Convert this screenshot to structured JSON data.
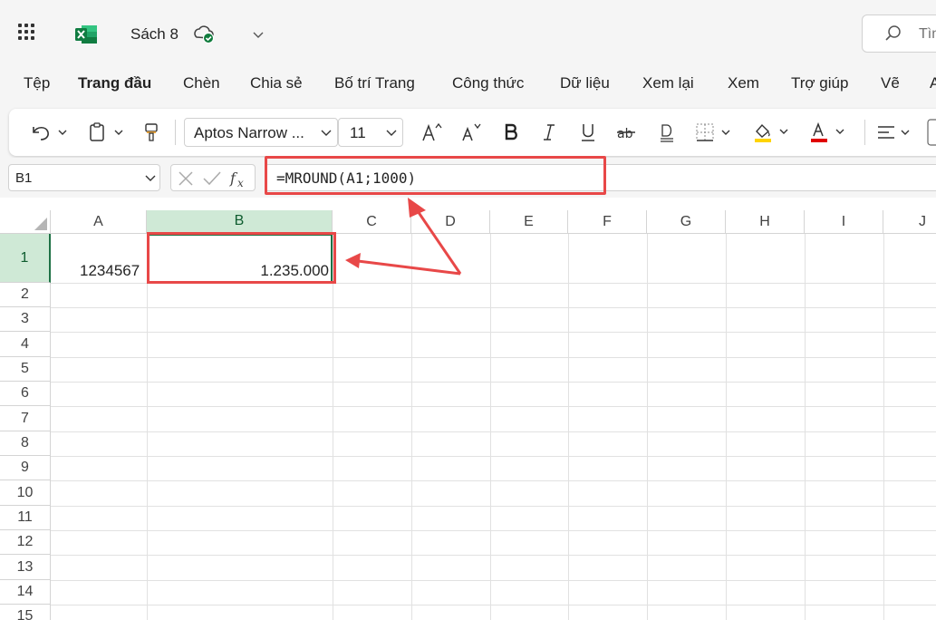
{
  "app": {
    "doc_title": "Sách 8",
    "search_placeholder": "Tìm"
  },
  "menu": {
    "tabs": [
      "Tệp",
      "Trang đầu",
      "Chèn",
      "Chia sẻ",
      "Bố trí Trang",
      "Công thức",
      "Dữ liệu",
      "Xem lại",
      "Xem",
      "Trợ giúp",
      "Vẽ",
      "A"
    ]
  },
  "ribbon": {
    "font_name": "Aptos Narrow ...",
    "font_size": "11",
    "highlight_color": "#ffd400",
    "font_color": "#e00000"
  },
  "formula_bar": {
    "name_box": "B1",
    "formula": "=MROUND(A1;1000)"
  },
  "grid": {
    "columns": [
      "A",
      "B",
      "C",
      "D",
      "E",
      "F",
      "G",
      "H",
      "I",
      "J"
    ],
    "rows": [
      "1",
      "2",
      "3",
      "4",
      "5",
      "6",
      "7",
      "8",
      "9",
      "10",
      "11",
      "12",
      "13",
      "14",
      "15"
    ],
    "cells": {
      "A1": "1234567",
      "B1": "1.235.000"
    },
    "selected_cell": "B1"
  },
  "annotations": {
    "highlight_color": "#e84848"
  }
}
